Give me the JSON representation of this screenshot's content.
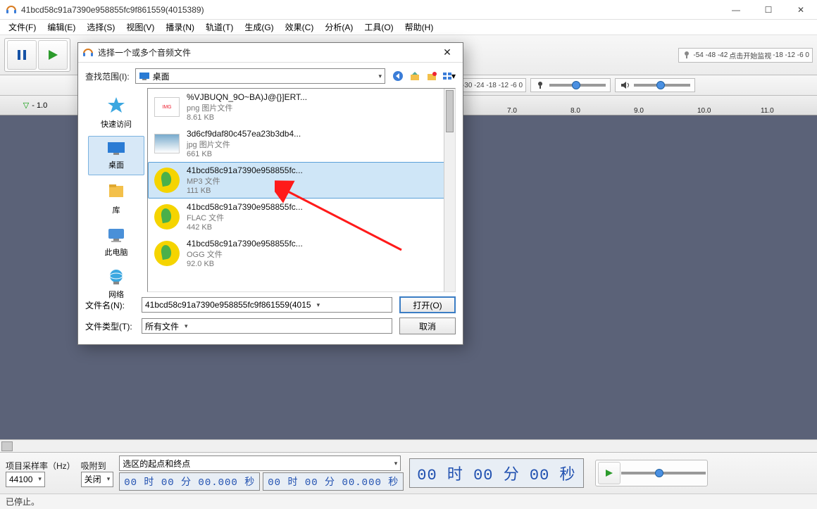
{
  "window": {
    "title": "41bcd58c91a7390e958855fc9f861559(4015389)"
  },
  "menu": {
    "file": "文件(F)",
    "edit": "编辑(E)",
    "select": "选择(S)",
    "view": "视图(V)",
    "transport": "播录(N)",
    "tracks": "轨道(T)",
    "generate": "生成(G)",
    "effect": "效果(C)",
    "analyze": "分析(A)",
    "tools": "工具(O)",
    "help": "帮助(H)"
  },
  "meters": {
    "rec_hint": "点击开始监视",
    "rec_ticks": "-54  -48  -42",
    "rec_ticks2": "-18  -12  -6   0",
    "play_ticks": "-54  -48  -42  -36  -30  -24  -18  -12  -6   0"
  },
  "ruler": {
    "pin_value": "- 1.0",
    "ticks": [
      "7.0",
      "8.0",
      "9.0",
      "10.0",
      "11.0"
    ]
  },
  "bottom": {
    "rate_label": "项目采样率（Hz）",
    "rate_value": "44100",
    "snap_label": "吸附到",
    "snap_value": "关闭",
    "selection_label": "选区的起点和终点",
    "time1": "00 时 00 分 00.000 秒",
    "time2": "00 时 00 分 00.000 秒",
    "bigtime": "00 时 00 分 00 秒"
  },
  "status": {
    "text": "已停止。"
  },
  "dialog": {
    "title": "选择一个或多个音频文件",
    "lookin_label": "查找范围(I):",
    "lookin_value": "桌面",
    "places": [
      {
        "label": "快速访问"
      },
      {
        "label": "桌面"
      },
      {
        "label": "库"
      },
      {
        "label": "此电脑"
      },
      {
        "label": "网络"
      }
    ],
    "files": [
      {
        "name": "%VJBUQN_9O~BA)J@{}]ERT...",
        "type": "png 图片文件",
        "size": "8.61 KB",
        "icon": "img1"
      },
      {
        "name": "3d6cf9daf80c457ea23b3db4...",
        "type": "jpg 图片文件",
        "size": "661 KB",
        "icon": "img2"
      },
      {
        "name": "41bcd58c91a7390e958855fc...",
        "type": "MP3 文件",
        "size": "111 KB",
        "icon": "qq",
        "selected": true
      },
      {
        "name": "41bcd58c91a7390e958855fc...",
        "type": "FLAC 文件",
        "size": "442 KB",
        "icon": "qq"
      },
      {
        "name": "41bcd58c91a7390e958855fc...",
        "type": "OGG 文件",
        "size": "92.0 KB",
        "icon": "qq"
      }
    ],
    "filename_label": "文件名(N):",
    "filename_value": "41bcd58c91a7390e958855fc9f861559(4015",
    "filetype_label": "文件类型(T):",
    "filetype_value": "所有文件",
    "open_btn": "打开(O)",
    "cancel_btn": "取消"
  }
}
